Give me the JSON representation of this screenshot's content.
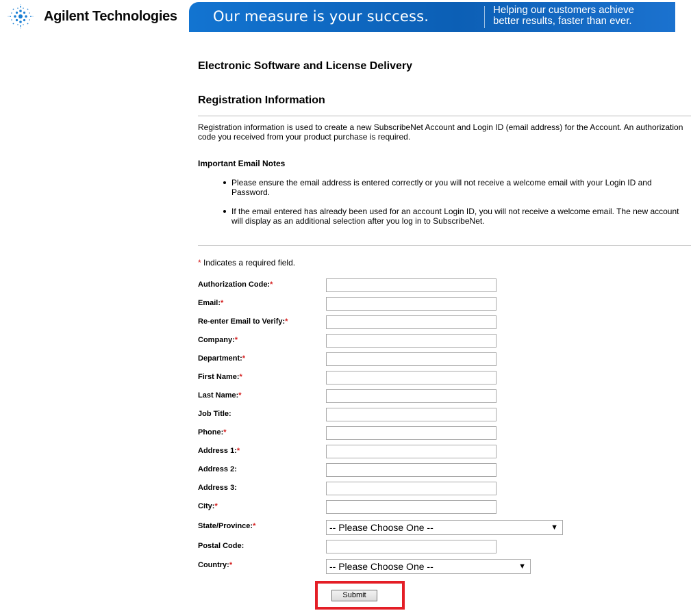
{
  "header": {
    "logo_text": "Agilent Technologies",
    "tagline": "Our measure is your success.",
    "sub_line1": "Helping our customers achieve",
    "sub_line2": "better results, faster than ever.",
    "brand_color": "#0c5fb5"
  },
  "page": {
    "title": "Electronic Software and License Delivery",
    "section_title": "Registration Information",
    "intro": "Registration information is used to create a new SubscribeNet Account and Login ID (email address) for the Account. An authorization code you received from your product purchase is required.",
    "notes_title": "Important Email Notes",
    "notes": [
      "Please ensure the email address is entered correctly or you will not receive a welcome email with your Login ID and Password.",
      "If the email entered has already been used for an account Login ID, you will not receive a welcome email. The new account will display as an additional selection after you log in to SubscribeNet."
    ],
    "required_note_star": "*",
    "required_note_text": " Indicates a required field."
  },
  "form": {
    "fields": [
      {
        "label": "Authorization Code:",
        "required": "*",
        "value": ""
      },
      {
        "label": "Email:",
        "required": "*",
        "value": ""
      },
      {
        "label": "Re-enter Email to Verify:",
        "required": "*",
        "value": ""
      },
      {
        "label": "Company:",
        "required": "*",
        "value": ""
      },
      {
        "label": "Department:",
        "required": "*",
        "value": ""
      },
      {
        "label": "First Name:",
        "required": "*",
        "value": ""
      },
      {
        "label": "Last Name:",
        "required": "*",
        "value": ""
      },
      {
        "label": "Job Title:",
        "required": "",
        "value": ""
      },
      {
        "label": "Phone:",
        "required": "*",
        "value": ""
      },
      {
        "label": "Address 1:",
        "required": "*",
        "value": ""
      },
      {
        "label": "Address 2:",
        "required": "",
        "value": ""
      },
      {
        "label": "Address 3:",
        "required": "",
        "value": ""
      },
      {
        "label": "City:",
        "required": "*",
        "value": ""
      }
    ],
    "state": {
      "label": "State/Province:",
      "required": "*",
      "selected": "-- Please Choose One --"
    },
    "postal": {
      "label": "Postal Code:",
      "required": "",
      "value": ""
    },
    "country": {
      "label": "Country:",
      "required": "*",
      "selected": "-- Please Choose One --"
    },
    "submit_label": "Submit",
    "highlight_color": "#e41e26"
  }
}
